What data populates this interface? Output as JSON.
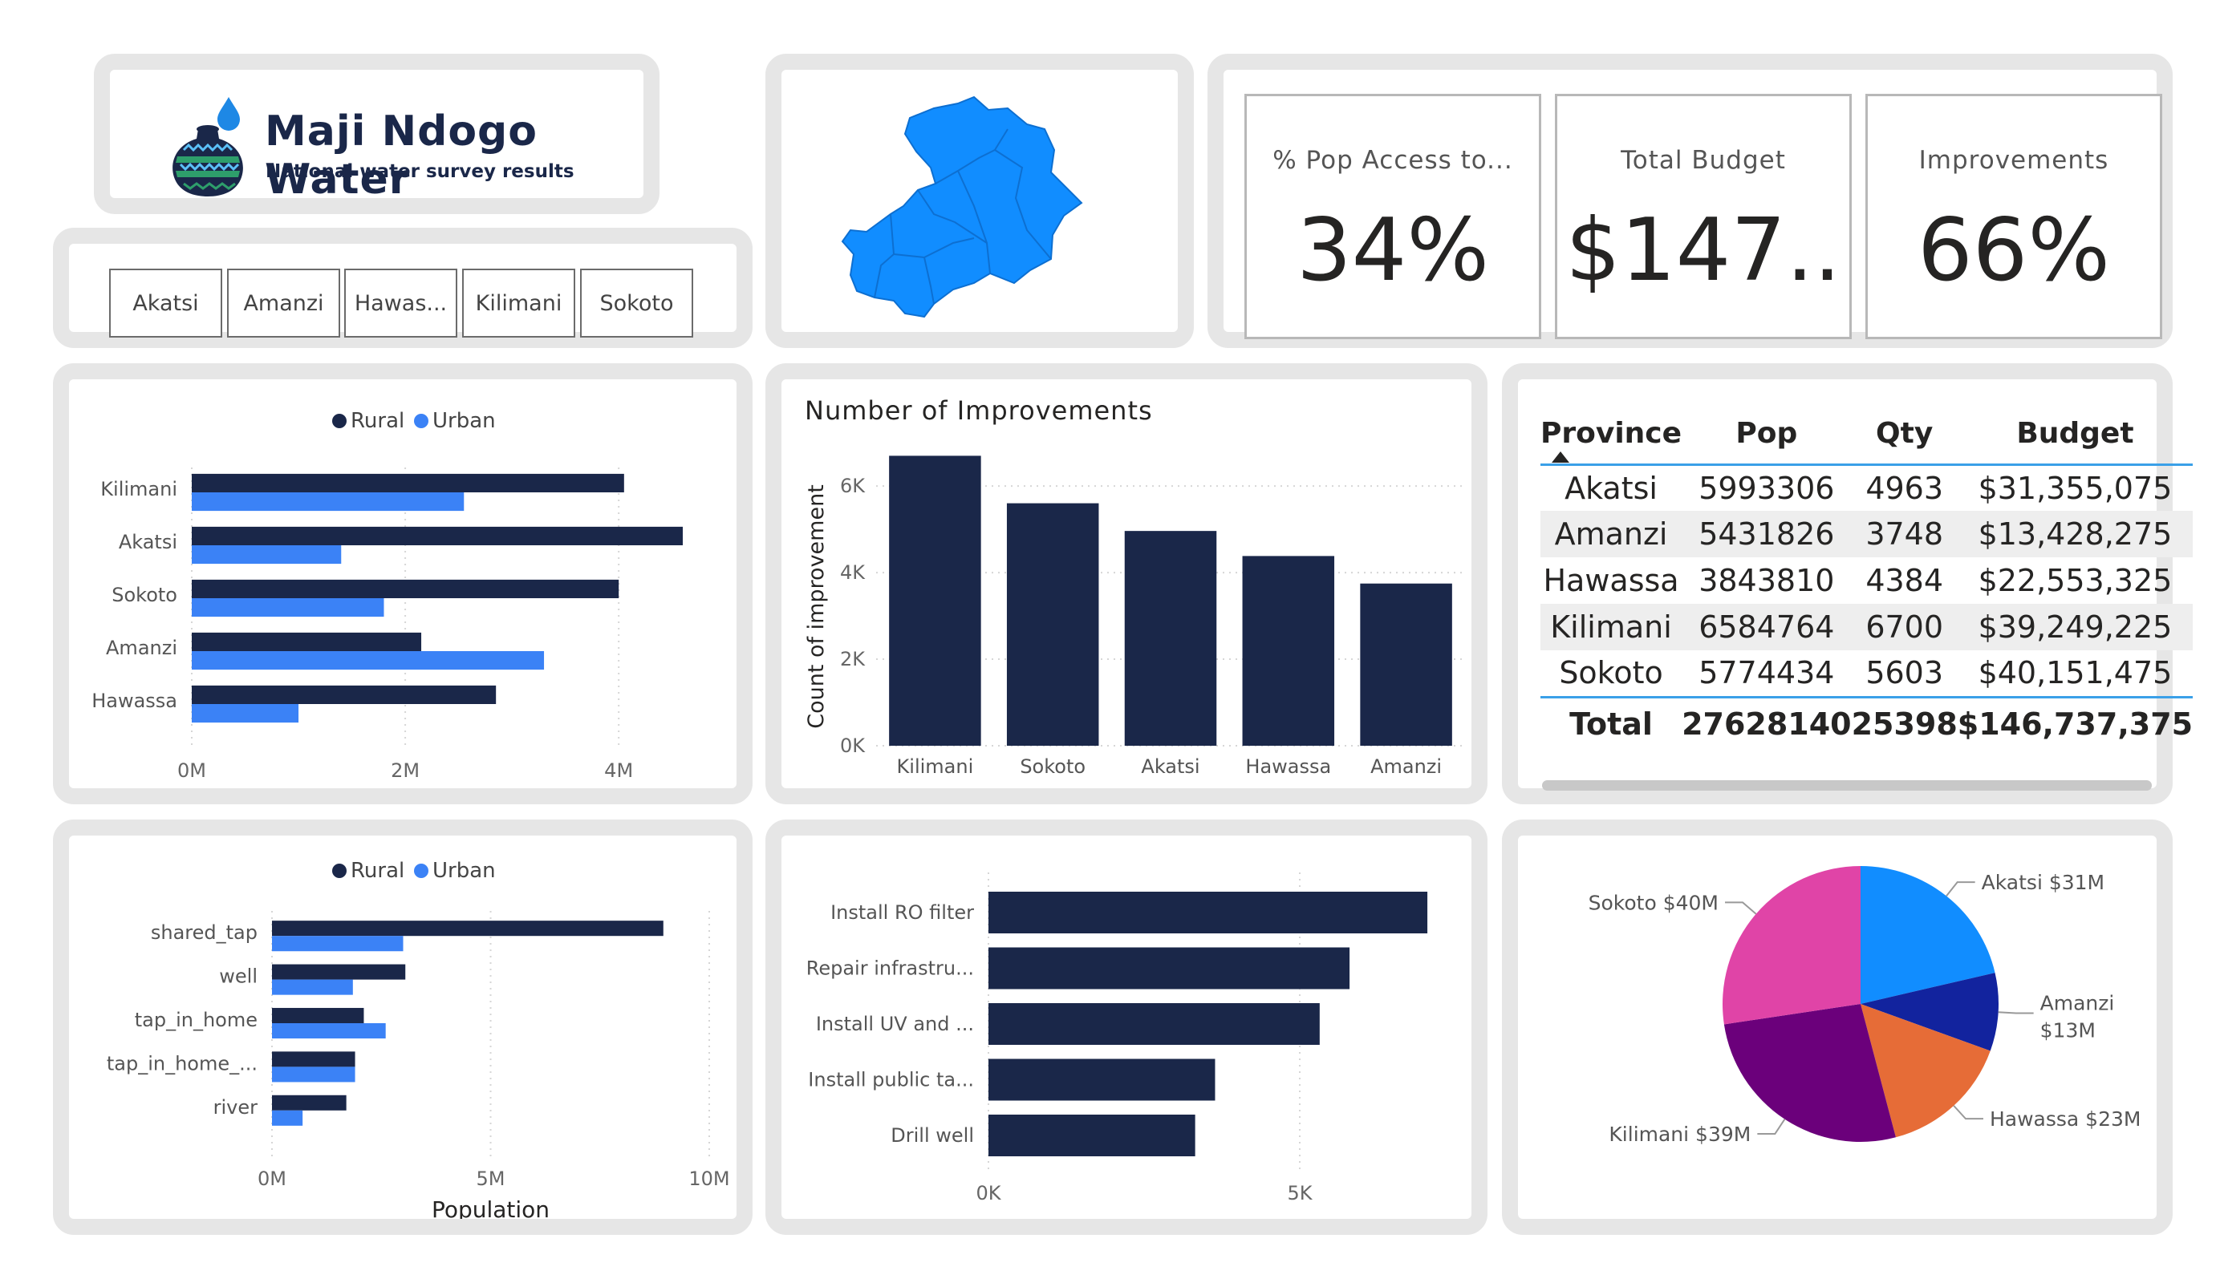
{
  "logo": {
    "title": "Maji Ndogo Water",
    "subtitle": "National water survey results"
  },
  "slicer": {
    "items": [
      "Akatsi",
      "Amanzi",
      "Hawas...",
      "Kilimani",
      "Sokoto"
    ]
  },
  "kpis": [
    {
      "label": "% Pop Access to...",
      "value": "34%"
    },
    {
      "label": "Total Budget",
      "value": "$147.."
    },
    {
      "label": "Improvements",
      "value": "66%"
    }
  ],
  "colors": {
    "rural": "#1a2749",
    "urban": "#3b82f6",
    "map_fill": "#118dff",
    "tile_border": "#e6e6e6"
  },
  "chart_data": [
    {
      "id": "population_by_province",
      "type": "bar",
      "orientation": "horizontal",
      "categories": [
        "Kilimani",
        "Akatsi",
        "Sokoto",
        "Amanzi",
        "Hawassa"
      ],
      "series": [
        {
          "name": "Rural",
          "values": [
            4.05,
            4.6,
            4.0,
            2.15,
            2.85
          ]
        },
        {
          "name": "Urban",
          "values": [
            2.55,
            1.4,
            1.8,
            3.3,
            1.0
          ]
        }
      ],
      "xlim": [
        0,
        4.6
      ],
      "xticks": [
        "0M",
        "2M",
        "4M"
      ],
      "xtick_values": [
        0,
        2,
        4
      ],
      "legend": "top",
      "grid": true
    },
    {
      "id": "number_of_improvements",
      "type": "bar",
      "orientation": "vertical",
      "title": "Number of Improvements",
      "ylabel": "Count of improvement",
      "categories": [
        "Kilimani",
        "Sokoto",
        "Akatsi",
        "Hawassa",
        "Amanzi"
      ],
      "values": [
        6700,
        5603,
        4963,
        4384,
        3748
      ],
      "ylim": [
        0,
        6800
      ],
      "yticks": [
        "0K",
        "2K",
        "4K",
        "6K"
      ],
      "ytick_values": [
        0,
        2000,
        4000,
        6000
      ],
      "grid": true
    },
    {
      "id": "population_by_source",
      "type": "bar",
      "orientation": "horizontal",
      "categories": [
        "shared_tap",
        "well",
        "tap_in_home",
        "tap_in_home_...",
        "river"
      ],
      "series": [
        {
          "name": "Rural",
          "values": [
            8.95,
            3.05,
            2.1,
            1.9,
            1.7
          ]
        },
        {
          "name": "Urban",
          "values": [
            3.0,
            1.85,
            2.6,
            1.9,
            0.7
          ]
        }
      ],
      "xlim": [
        0,
        10
      ],
      "xticks": [
        "0M",
        "5M",
        "10M"
      ],
      "xtick_values": [
        0,
        5,
        10
      ],
      "xlabel": "Population",
      "legend": "top",
      "grid": true
    },
    {
      "id": "improvements_by_type",
      "type": "bar",
      "orientation": "horizontal",
      "categories": [
        "Install RO filter",
        "Repair infrastru...",
        "Install UV and ...",
        "Install public ta...",
        "Drill well"
      ],
      "values": [
        7050,
        5800,
        5320,
        3640,
        3320
      ],
      "xlim": [
        0,
        7500
      ],
      "xticks": [
        "0K",
        "5K"
      ],
      "xtick_values": [
        0,
        5000
      ],
      "grid": true
    },
    {
      "id": "budget_by_province",
      "type": "pie",
      "labels": [
        "Akatsi $31M",
        "Amanzi $13M",
        "Hawassa $23M",
        "Kilimani $39M",
        "Sokoto $40M"
      ],
      "categories": [
        "Akatsi",
        "Amanzi",
        "Hawassa",
        "Kilimani",
        "Sokoto"
      ],
      "values": [
        31355075,
        13428275,
        22553325,
        39249225,
        40151475
      ],
      "colors": [
        "#118dff",
        "#12239e",
        "#e66c37",
        "#6b007b",
        "#e044a7"
      ]
    }
  ],
  "table": {
    "headers": [
      "Province",
      "Pop",
      "Qty",
      "Budget"
    ],
    "rows": [
      [
        "Akatsi",
        "5993306",
        "4963",
        "$31,355,075"
      ],
      [
        "Amanzi",
        "5431826",
        "3748",
        "$13,428,275"
      ],
      [
        "Hawassa",
        "3843810",
        "4384",
        "$22,553,325"
      ],
      [
        "Kilimani",
        "6584764",
        "6700",
        "$39,249,225"
      ],
      [
        "Sokoto",
        "5774434",
        "5603",
        "$40,151,475"
      ]
    ],
    "total": [
      "Total",
      "27628140",
      "25398",
      "$146,737,375"
    ]
  },
  "legend": {
    "rural": "Rural",
    "urban": "Urban"
  }
}
